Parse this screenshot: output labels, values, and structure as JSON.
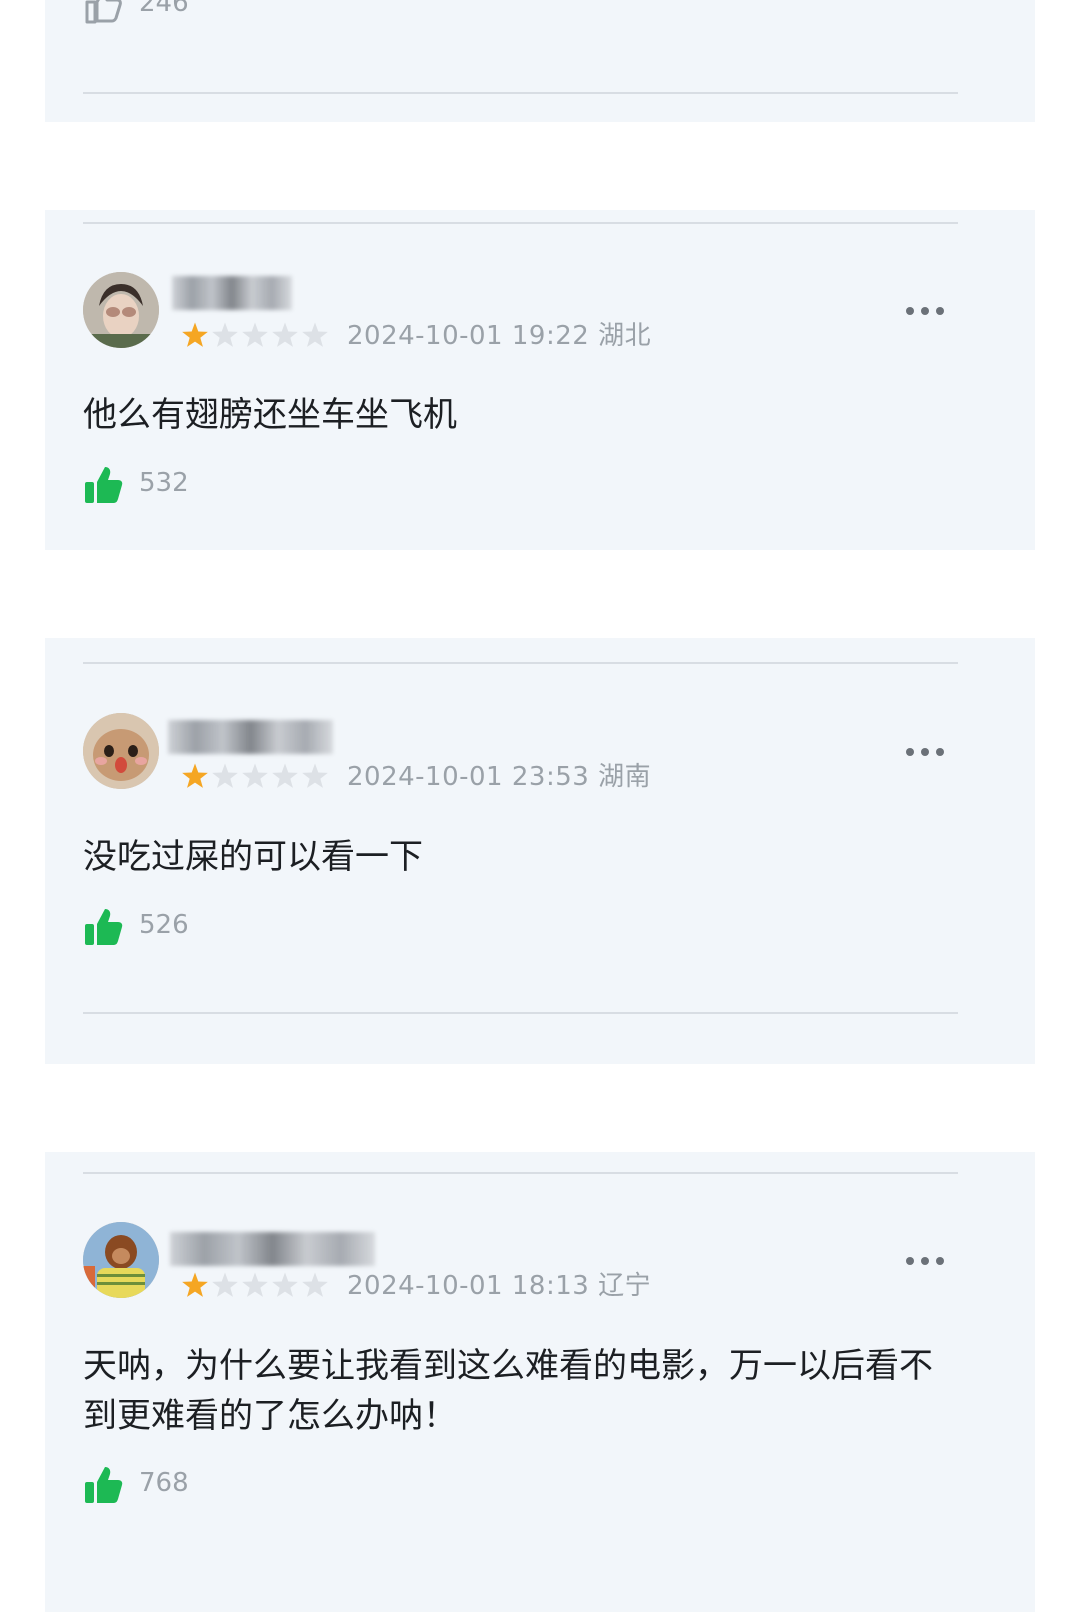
{
  "top_partial": {
    "likes": "246"
  },
  "comments": [
    {
      "date": "2024-10-01 19:22",
      "region": "湖北",
      "rating": 1,
      "max_rating": 5,
      "text": "他么有翅膀还坐车坐飞机",
      "likes": "532"
    },
    {
      "date": "2024-10-01 23:53",
      "region": "湖南",
      "rating": 1,
      "max_rating": 5,
      "text": "没吃过屎的可以看一下",
      "likes": "526"
    },
    {
      "date": "2024-10-01 18:13",
      "region": "辽宁",
      "rating": 1,
      "max_rating": 5,
      "text": "天呐，为什么要让我看到这么难看的电影，万一以后看不到更难看的了怎么办呐！",
      "likes": "768"
    }
  ],
  "colors": {
    "card_bg": "#f2f6fa",
    "star_filled": "#f5a623",
    "star_empty": "#dde1e6",
    "thumb_green": "#1db954",
    "meta_gray": "#9aa1a8"
  },
  "icons": {
    "like": "thumbs-up-icon",
    "more": "more-dots-icon",
    "star": "star-icon"
  }
}
